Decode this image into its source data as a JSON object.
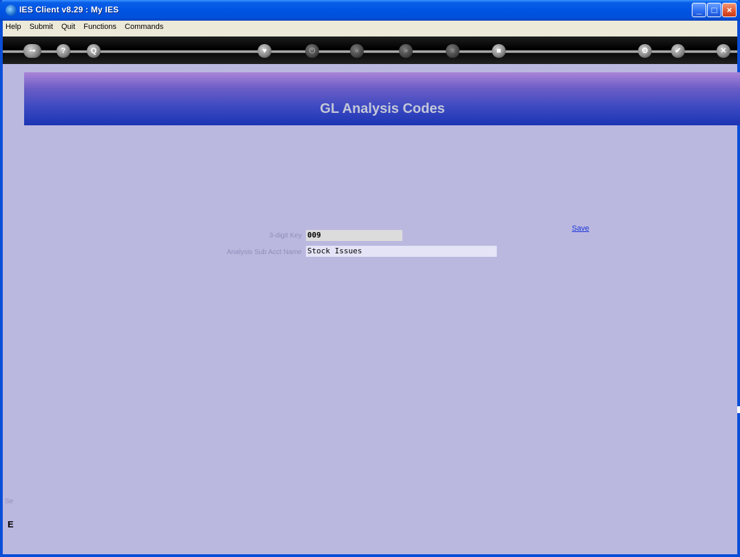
{
  "window": {
    "title": "IES Client v8.29 : My IES"
  },
  "menu": [
    "Help",
    "Submit",
    "Quit",
    "Functions",
    "Commands"
  ],
  "toolbar": {
    "icons": [
      "key-icon",
      "help-icon",
      "search-icon",
      "heart-icon",
      "power-icon",
      "rewind-icon",
      "forward-icon",
      "list-icon",
      "stop-icon",
      "gear-icon",
      "check-icon",
      "close-icon"
    ],
    "help_glyph": "?",
    "search_glyph": "Q",
    "heart_glyph": "♥",
    "power_glyph": "⏻",
    "rewind_glyph": "«",
    "forward_glyph": "»",
    "list_glyph": "≡",
    "stop_glyph": "■",
    "gear_glyph": "⚙",
    "check_glyph": "✔",
    "close_glyph": "✕"
  },
  "page": {
    "title": "GL Analysis Codes"
  },
  "form": {
    "key_label": "3-digit Key",
    "key_value": "009",
    "name_label": "Analysis Sub Acct Name",
    "name_value": "Stock Issues",
    "save_label": "Save"
  },
  "side": {
    "fragment1": "Se",
    "fragment2": "E"
  },
  "colors": {
    "content_bg": "#bbb8e0",
    "banner_start": "#a985d8",
    "banner_end": "#1c34b4",
    "link": "#1a36d8"
  }
}
